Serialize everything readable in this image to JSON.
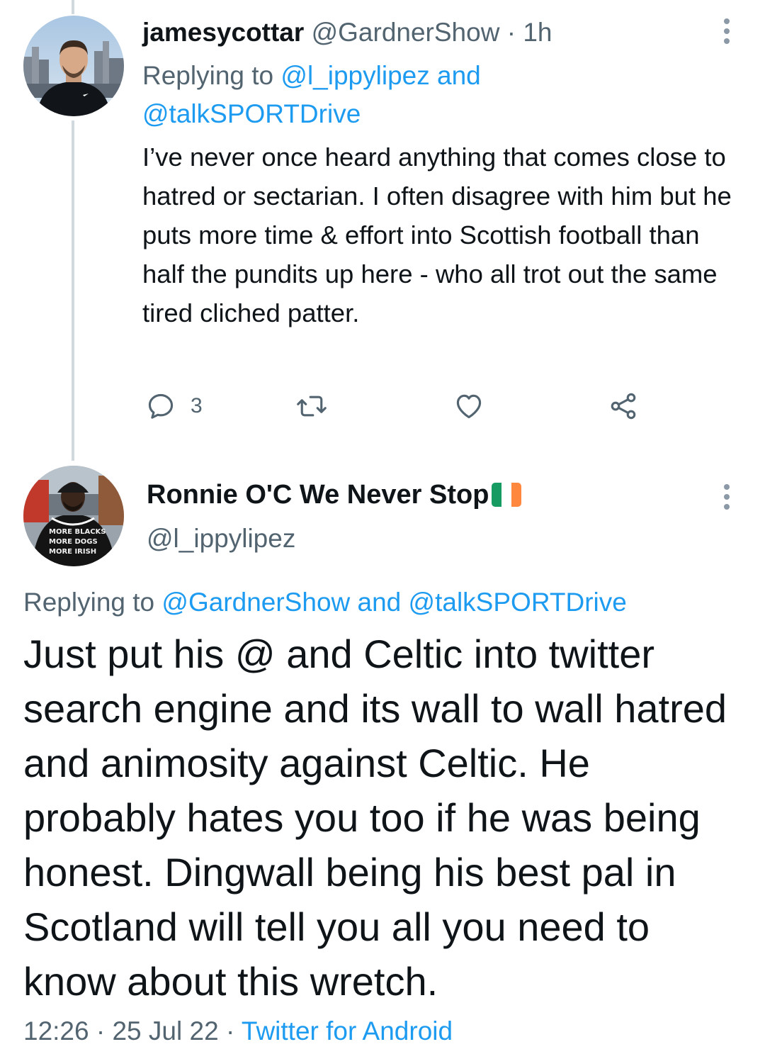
{
  "reply_tweet": {
    "display_name": "jamesycottar",
    "handle": "@GardnerShow",
    "separator": "·",
    "time": "1h",
    "replying_to_prefix": "Replying to",
    "mention_1": "@l_ippylipez",
    "mention_joiner": "and",
    "mention_2": "@talkSPORTDrive",
    "text": "I’ve never once heard anything that comes close to hatred or sectarian. I often disagree with him but he puts more time & effort into Scottish football than half the pundits up here - who all trot out the same tired cliched patter.",
    "reply_count": "3",
    "icons": [
      "reply-icon",
      "retweet-icon",
      "like-icon",
      "share-icon",
      "more-icon"
    ]
  },
  "main_tweet": {
    "display_name": "Ronnie O'C We Never Stop",
    "flag_colors": [
      "#169b62",
      "#ffffff",
      "#ff883e"
    ],
    "handle": "@l_ippylipez",
    "replying_to_prefix": "Replying to",
    "mention_1": "@GardnerShow",
    "mention_joiner": "and",
    "mention_2": "@talkSPORTDrive",
    "text": "Just put his @ and Celtic into twitter search engine and its wall to wall hatred and animosity against Celtic. He probably hates you too if he was being honest. Dingwall being his best pal in Scotland will tell you all you need to know about this wretch.",
    "time": "12:26",
    "separator": "·",
    "date": "25 Jul 22",
    "source": "Twitter for Android",
    "avatar_shirt_text": [
      "MORE BLACKS",
      "MORE DOGS",
      "MORE IRISH"
    ]
  },
  "colors": {
    "link": "#1d9bf0",
    "secondary_text": "#536471",
    "primary_text": "#0f1419",
    "thread_line": "#cfd9de"
  }
}
